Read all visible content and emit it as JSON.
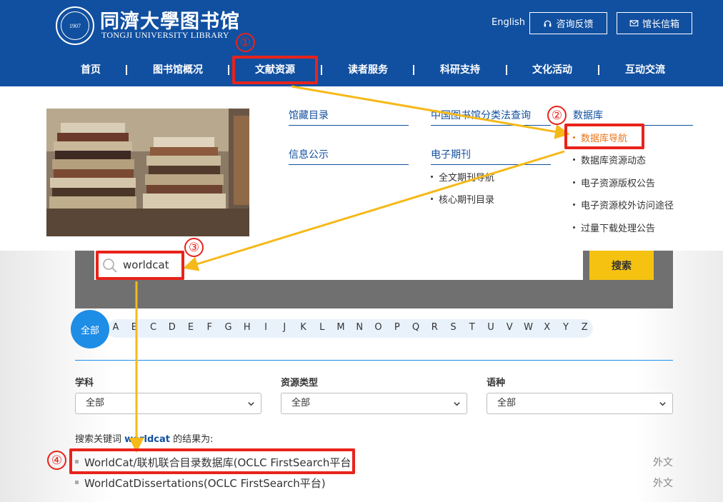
{
  "header": {
    "logo_cn": "同濟大學图书馆",
    "logo_en": "TONGJI UNIVERSITY LIBRARY",
    "language_link": "English",
    "consult_button": "咨询反馈",
    "director_mailbox_button": "馆长信箱"
  },
  "nav": {
    "items": [
      {
        "label": "首页"
      },
      {
        "label": "图书馆概况"
      },
      {
        "label": "文献资源"
      },
      {
        "label": "读者服务"
      },
      {
        "label": "科研支持"
      },
      {
        "label": "文化活动"
      },
      {
        "label": "互动交流"
      }
    ],
    "active_index": 2
  },
  "dropdown": {
    "columns": [
      {
        "title": "馆藏目录",
        "items": []
      },
      {
        "title": "信息公示",
        "items": []
      },
      {
        "title": "中国图书馆分类法查询",
        "items": []
      },
      {
        "title": "电子期刊",
        "items": [
          "全文期刊导航",
          "核心期刊目录"
        ]
      },
      {
        "title": "数据库",
        "items": [
          "数据库导航",
          "数据库资源动态",
          "电子资源版权公告",
          "电子资源校外访问途径",
          "过量下载处理公告"
        ]
      }
    ],
    "active_item": "数据库导航"
  },
  "search": {
    "value": "worldcat",
    "button_label": "搜索"
  },
  "alphabet": {
    "all_label": "全部",
    "letters": [
      "A",
      "B",
      "C",
      "D",
      "E",
      "F",
      "G",
      "H",
      "I",
      "J",
      "K",
      "L",
      "M",
      "N",
      "O",
      "P",
      "Q",
      "R",
      "S",
      "T",
      "U",
      "V",
      "W",
      "X",
      "Y",
      "Z"
    ]
  },
  "filters": [
    {
      "label": "学科",
      "selected": "全部"
    },
    {
      "label": "资源类型",
      "selected": "全部"
    },
    {
      "label": "语种",
      "selected": "全部"
    }
  ],
  "results": {
    "summary_prefix": "搜索关键词",
    "keyword": "worldcat",
    "summary_suffix": "的结果为:",
    "items": [
      {
        "title": "WorldCat/联机联合目录数据库(OCLC FirstSearch平台)",
        "language": "外文"
      },
      {
        "title": "WorldCatDissertations(OCLC FirstSearch平台)",
        "language": "外文"
      }
    ]
  },
  "annotations": {
    "steps": [
      "①",
      "②",
      "③",
      "④"
    ],
    "box_color": "#e8231b",
    "arrow_color": "#f5b919"
  },
  "colors": {
    "brand_blue": "#1150a0",
    "accent_blue": "#1e8de6",
    "search_button": "#f5c212",
    "active_link": "#e8751a"
  }
}
